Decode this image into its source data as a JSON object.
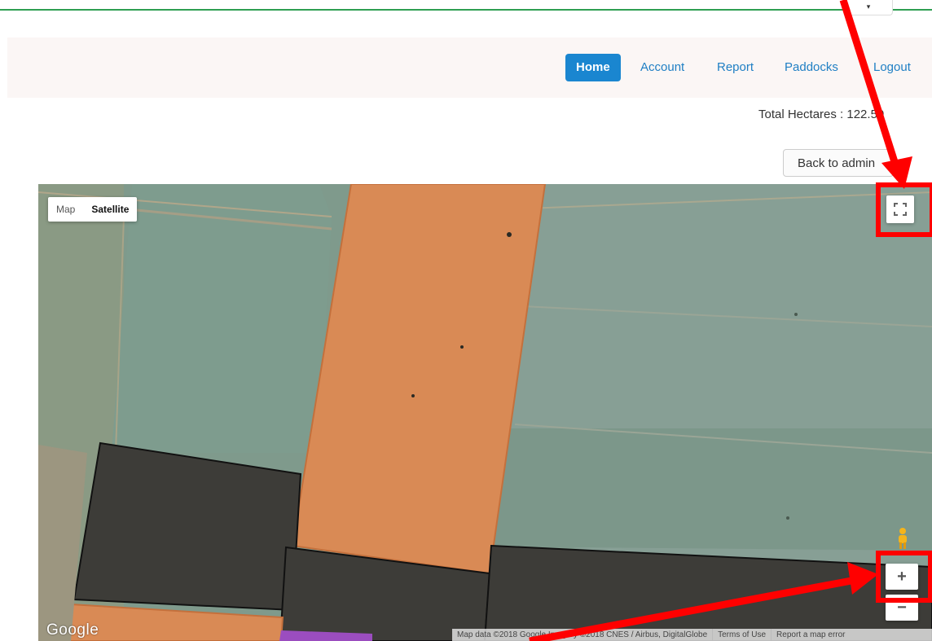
{
  "top_dropdown": {
    "caret": "▾"
  },
  "nav": {
    "items": [
      {
        "label": "Home",
        "active": true
      },
      {
        "label": "Account",
        "active": false
      },
      {
        "label": "Report",
        "active": false
      },
      {
        "label": "Paddocks",
        "active": false
      },
      {
        "label": "Logout",
        "active": false
      }
    ]
  },
  "summary": {
    "total_hectares": "Total Hectares : 122.50"
  },
  "buttons": {
    "back_to_admin": "Back to admin"
  },
  "map": {
    "type_control": {
      "map_label": "Map",
      "satellite_label": "Satellite",
      "selected": "Satellite"
    },
    "logo": "Google",
    "attribution": {
      "data": "Map data ©2018 Google Imagery ©2018 CNES / Airbus, DigitalGlobe",
      "terms": "Terms of Use",
      "report": "Report a map error"
    },
    "controls": {
      "zoom_in": "+",
      "zoom_out": "−"
    },
    "icons": [
      "fullscreen-icon",
      "pegman-icon"
    ],
    "colors": {
      "orange_paddock": "#d98a55",
      "dark_paddock": "#3d3c38",
      "purple_paddock": "#9b4dbf",
      "annotation": "#ff0000"
    }
  }
}
